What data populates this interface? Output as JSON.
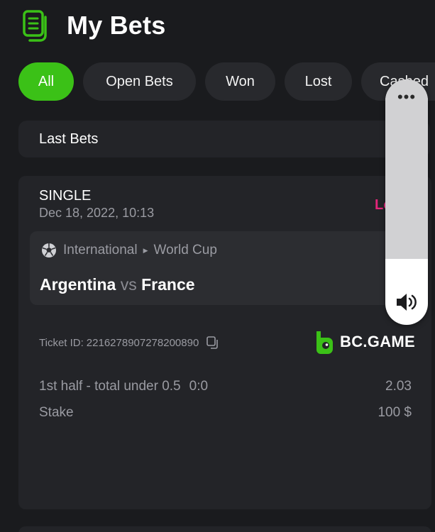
{
  "header": {
    "title": "My Bets",
    "icon": "bet-slip-icon"
  },
  "tabs": [
    {
      "label": "All",
      "active": true
    },
    {
      "label": "Open Bets",
      "active": false
    },
    {
      "label": "Won",
      "active": false
    },
    {
      "label": "Lost",
      "active": false
    },
    {
      "label": "Cashed",
      "active": false
    }
  ],
  "section": {
    "label": "Last Bets"
  },
  "bet": {
    "type": "SINGLE",
    "date": "Dec 18, 2022, 10:13",
    "status": "Lost",
    "league": {
      "country": "International",
      "competition": "World Cup",
      "icon": "soccer-ball-icon"
    },
    "teams": {
      "home": "Argentina",
      "vs": "vs",
      "away": "France"
    },
    "ticket_label": "Ticket ID:",
    "ticket_id": "2216278907278200890",
    "brand": "BC.GAME",
    "selection": "1st half - total under 0.5",
    "score": "0:0",
    "odds": "2.03",
    "stake_label": "Stake",
    "stake_value": "100 $"
  },
  "overlay": {
    "menu": "•••",
    "icon": "speaker-volume-icon",
    "volume_level": 0.27
  },
  "colors": {
    "background": "#1a1b1e",
    "card": "#232428",
    "accent_green": "#3bc117",
    "status_lost": "#e4257a",
    "muted_text": "#9a9ba2"
  }
}
